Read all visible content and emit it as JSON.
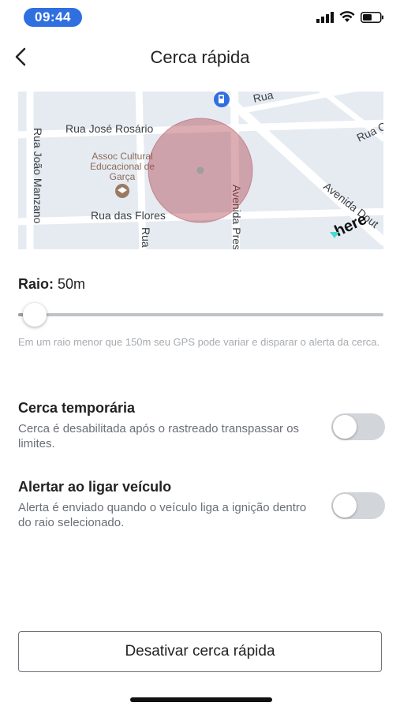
{
  "status_bar": {
    "time": "09:44"
  },
  "header": {
    "title": "Cerca rápida"
  },
  "map": {
    "streets": [
      "Rua José Rosário",
      "Rua João Manzano",
      "Rua das Flores",
      "Avenida Pres",
      "Rua",
      "Rua",
      "Rua C",
      "Avenida Dout"
    ],
    "poi_label_lines": [
      "Assoc Cultural",
      "Educacional de",
      "Garça"
    ],
    "provider": "here",
    "fence_color": "#b24a55"
  },
  "radius": {
    "label": "Raio:",
    "value": "50m",
    "level": 0.03
  },
  "hint": "Em um raio menor que 150m seu GPS pode variar e disparar o alerta da cerca.",
  "options": [
    {
      "title": "Cerca temporária",
      "description": "Cerca é desabilitada após o rastreado transpassar os limites.",
      "enabled": false
    },
    {
      "title": "Alertar ao ligar veículo",
      "description": "Alerta é enviado quando o veículo liga a ignição dentro do raio selecionado.",
      "enabled": false
    }
  ],
  "actions": {
    "deactivate_label": "Desativar cerca rápida"
  },
  "colors": {
    "accent": "#2f6fe0",
    "toggle_off": "#d2d5d9"
  }
}
